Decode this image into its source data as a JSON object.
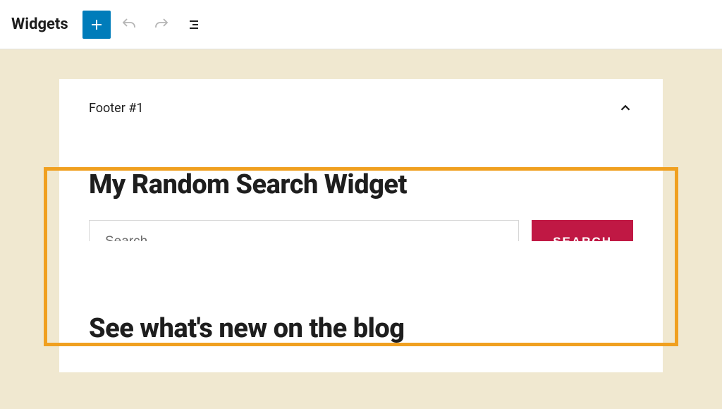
{
  "toolbar": {
    "title": "Widgets"
  },
  "panel": {
    "header": "Footer #1"
  },
  "widget": {
    "title": "My Random Search Widget",
    "search_placeholder": "Search…",
    "search_button": "SEARCH"
  },
  "section": {
    "title": "See what's new on the blog"
  },
  "colors": {
    "primary": "#007cba",
    "highlight": "#f0a020",
    "action": "#c01844",
    "canvas": "#f0e8d0"
  }
}
